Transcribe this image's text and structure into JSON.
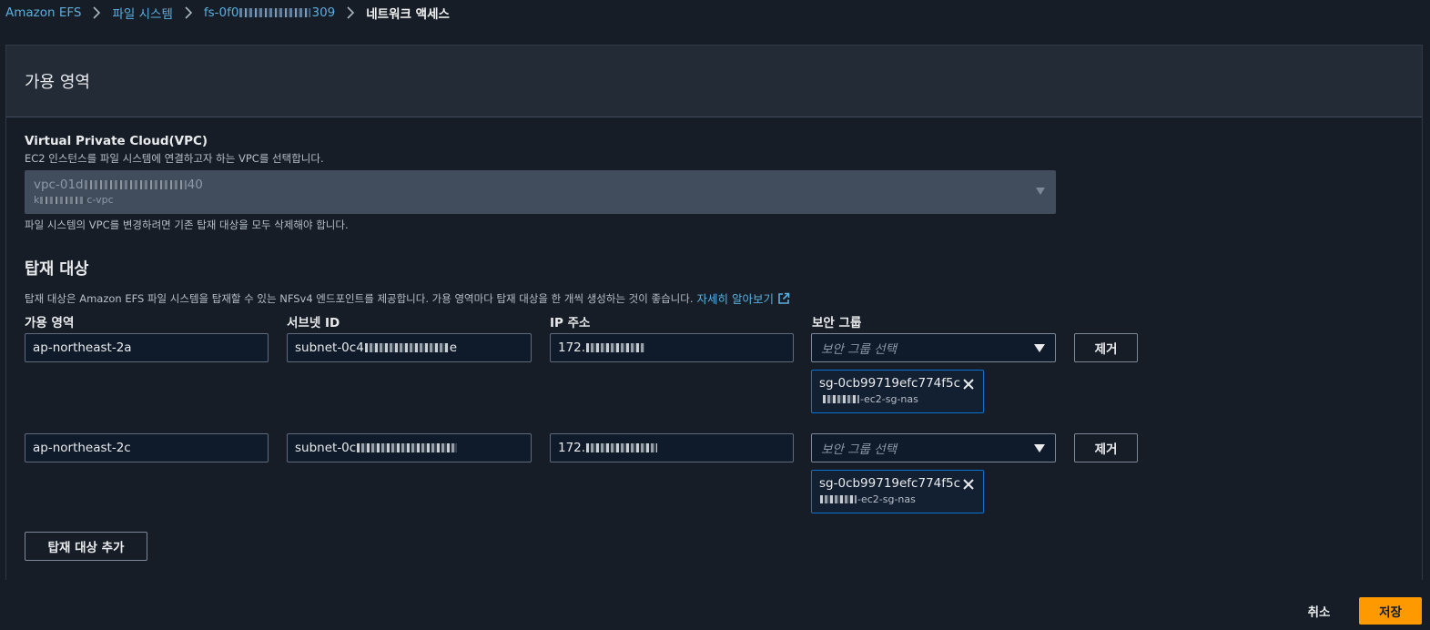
{
  "breadcrumb": {
    "service": "Amazon EFS",
    "file_systems": "파일 시스템",
    "fs_id_prefix": "fs-0f0",
    "fs_id_suffix": "309",
    "current": "네트워크 액세스"
  },
  "panel": {
    "title": "가용 영역"
  },
  "vpc": {
    "label": "Virtual Private Cloud(VPC)",
    "description": "EC2 인스턴스를 파일 시스템에 연결하고자 하는 VPC를 선택합니다.",
    "selected_id_prefix": "vpc-01d",
    "selected_id_suffix": "40",
    "selected_name_prefix": "k",
    "selected_name_suffix": "c-vpc",
    "constraint": "파일 시스템의 VPC를 변경하려면 기존 탑재 대상을 모두 삭제해야 합니다."
  },
  "mount_targets": {
    "title": "탑재 대상",
    "description": "탑재 대상은 Amazon EFS 파일 시스템을 탑재할 수 있는 NFSv4 엔드포인트를 제공합니다. 가용 영역마다 탑재 대상을 한 개씩 생성하는 것이 좋습니다.",
    "learn_more": "자세히 알아보기",
    "col_az": "가용 영역",
    "col_subnet": "서브넷 ID",
    "col_ip": "IP 주소",
    "col_sg": "보안 그룹",
    "rows": [
      {
        "az": "ap-northeast-2a",
        "subnet_prefix": "subnet-0c4",
        "subnet_suffix": "e",
        "ip_prefix": "172.",
        "sg_placeholder": "보안 그룹 선택",
        "remove_label": "제거",
        "sg_token_id": "sg-0cb99719efc774f5c",
        "sg_token_name_suffix": "-ec2-sg-nas"
      },
      {
        "az": "ap-northeast-2c",
        "subnet_prefix": "subnet-0c",
        "subnet_suffix": "",
        "ip_prefix": "172.",
        "sg_placeholder": "보안 그룹 선택",
        "remove_label": "제거",
        "sg_token_id": "sg-0cb99719efc774f5c",
        "sg_token_name_suffix": "-ec2-sg-nas"
      }
    ],
    "add_label": "탑재 대상 추가"
  },
  "footer": {
    "cancel_label": "취소",
    "save_label": "저장"
  },
  "colors": {
    "link": "#5aafe0",
    "primary_button": "#ff9900",
    "token_border": "#0972d3",
    "background": "#161d26"
  }
}
